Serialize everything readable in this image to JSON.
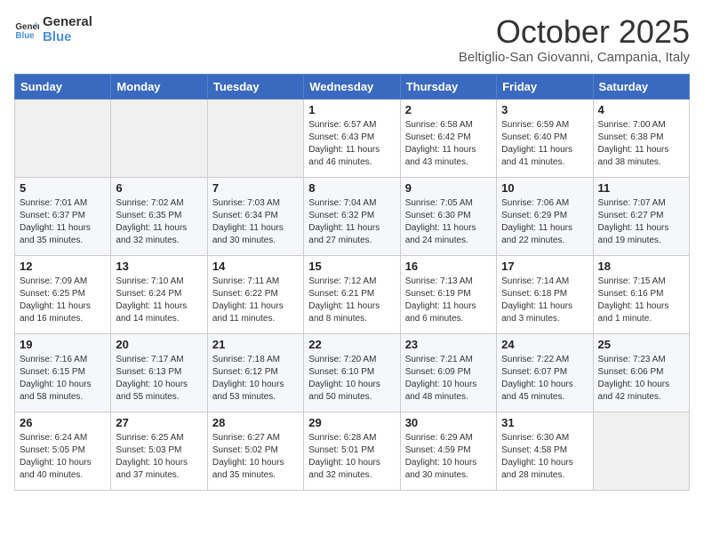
{
  "header": {
    "logo_line1": "General",
    "logo_line2": "Blue",
    "title": "October 2025",
    "subtitle": "Beltiglio-San Giovanni, Campania, Italy"
  },
  "days_of_week": [
    "Sunday",
    "Monday",
    "Tuesday",
    "Wednesday",
    "Thursday",
    "Friday",
    "Saturday"
  ],
  "weeks": [
    [
      {
        "day": "",
        "info": ""
      },
      {
        "day": "",
        "info": ""
      },
      {
        "day": "",
        "info": ""
      },
      {
        "day": "1",
        "info": "Sunrise: 6:57 AM\nSunset: 6:43 PM\nDaylight: 11 hours\nand 46 minutes."
      },
      {
        "day": "2",
        "info": "Sunrise: 6:58 AM\nSunset: 6:42 PM\nDaylight: 11 hours\nand 43 minutes."
      },
      {
        "day": "3",
        "info": "Sunrise: 6:59 AM\nSunset: 6:40 PM\nDaylight: 11 hours\nand 41 minutes."
      },
      {
        "day": "4",
        "info": "Sunrise: 7:00 AM\nSunset: 6:38 PM\nDaylight: 11 hours\nand 38 minutes."
      }
    ],
    [
      {
        "day": "5",
        "info": "Sunrise: 7:01 AM\nSunset: 6:37 PM\nDaylight: 11 hours\nand 35 minutes."
      },
      {
        "day": "6",
        "info": "Sunrise: 7:02 AM\nSunset: 6:35 PM\nDaylight: 11 hours\nand 32 minutes."
      },
      {
        "day": "7",
        "info": "Sunrise: 7:03 AM\nSunset: 6:34 PM\nDaylight: 11 hours\nand 30 minutes."
      },
      {
        "day": "8",
        "info": "Sunrise: 7:04 AM\nSunset: 6:32 PM\nDaylight: 11 hours\nand 27 minutes."
      },
      {
        "day": "9",
        "info": "Sunrise: 7:05 AM\nSunset: 6:30 PM\nDaylight: 11 hours\nand 24 minutes."
      },
      {
        "day": "10",
        "info": "Sunrise: 7:06 AM\nSunset: 6:29 PM\nDaylight: 11 hours\nand 22 minutes."
      },
      {
        "day": "11",
        "info": "Sunrise: 7:07 AM\nSunset: 6:27 PM\nDaylight: 11 hours\nand 19 minutes."
      }
    ],
    [
      {
        "day": "12",
        "info": "Sunrise: 7:09 AM\nSunset: 6:25 PM\nDaylight: 11 hours\nand 16 minutes."
      },
      {
        "day": "13",
        "info": "Sunrise: 7:10 AM\nSunset: 6:24 PM\nDaylight: 11 hours\nand 14 minutes."
      },
      {
        "day": "14",
        "info": "Sunrise: 7:11 AM\nSunset: 6:22 PM\nDaylight: 11 hours\nand 11 minutes."
      },
      {
        "day": "15",
        "info": "Sunrise: 7:12 AM\nSunset: 6:21 PM\nDaylight: 11 hours\nand 8 minutes."
      },
      {
        "day": "16",
        "info": "Sunrise: 7:13 AM\nSunset: 6:19 PM\nDaylight: 11 hours\nand 6 minutes."
      },
      {
        "day": "17",
        "info": "Sunrise: 7:14 AM\nSunset: 6:18 PM\nDaylight: 11 hours\nand 3 minutes."
      },
      {
        "day": "18",
        "info": "Sunrise: 7:15 AM\nSunset: 6:16 PM\nDaylight: 11 hours\nand 1 minute."
      }
    ],
    [
      {
        "day": "19",
        "info": "Sunrise: 7:16 AM\nSunset: 6:15 PM\nDaylight: 10 hours\nand 58 minutes."
      },
      {
        "day": "20",
        "info": "Sunrise: 7:17 AM\nSunset: 6:13 PM\nDaylight: 10 hours\nand 55 minutes."
      },
      {
        "day": "21",
        "info": "Sunrise: 7:18 AM\nSunset: 6:12 PM\nDaylight: 10 hours\nand 53 minutes."
      },
      {
        "day": "22",
        "info": "Sunrise: 7:20 AM\nSunset: 6:10 PM\nDaylight: 10 hours\nand 50 minutes."
      },
      {
        "day": "23",
        "info": "Sunrise: 7:21 AM\nSunset: 6:09 PM\nDaylight: 10 hours\nand 48 minutes."
      },
      {
        "day": "24",
        "info": "Sunrise: 7:22 AM\nSunset: 6:07 PM\nDaylight: 10 hours\nand 45 minutes."
      },
      {
        "day": "25",
        "info": "Sunrise: 7:23 AM\nSunset: 6:06 PM\nDaylight: 10 hours\nand 42 minutes."
      }
    ],
    [
      {
        "day": "26",
        "info": "Sunrise: 6:24 AM\nSunset: 5:05 PM\nDaylight: 10 hours\nand 40 minutes."
      },
      {
        "day": "27",
        "info": "Sunrise: 6:25 AM\nSunset: 5:03 PM\nDaylight: 10 hours\nand 37 minutes."
      },
      {
        "day": "28",
        "info": "Sunrise: 6:27 AM\nSunset: 5:02 PM\nDaylight: 10 hours\nand 35 minutes."
      },
      {
        "day": "29",
        "info": "Sunrise: 6:28 AM\nSunset: 5:01 PM\nDaylight: 10 hours\nand 32 minutes."
      },
      {
        "day": "30",
        "info": "Sunrise: 6:29 AM\nSunset: 4:59 PM\nDaylight: 10 hours\nand 30 minutes."
      },
      {
        "day": "31",
        "info": "Sunrise: 6:30 AM\nSunset: 4:58 PM\nDaylight: 10 hours\nand 28 minutes."
      },
      {
        "day": "",
        "info": ""
      }
    ]
  ]
}
